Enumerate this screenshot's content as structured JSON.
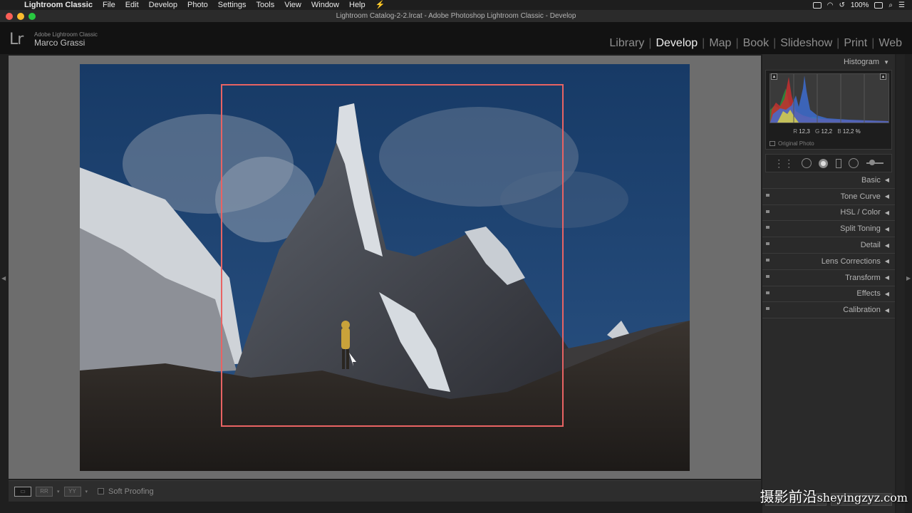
{
  "menubar": {
    "apple": "",
    "app_name": "Lightroom Classic",
    "items": [
      "File",
      "Edit",
      "Develop",
      "Photo",
      "Settings",
      "Tools",
      "View",
      "Window",
      "Help"
    ],
    "battery": "100%"
  },
  "window": {
    "title": "Lightroom Catalog-2-2.lrcat - Adobe Photoshop Lightroom Classic - Develop"
  },
  "identity": {
    "logo": "Lr",
    "product": "Adobe Lightroom Classic",
    "user": "Marco Grassi"
  },
  "modules": [
    {
      "label": "Library",
      "active": false
    },
    {
      "label": "Develop",
      "active": true
    },
    {
      "label": "Map",
      "active": false
    },
    {
      "label": "Book",
      "active": false
    },
    {
      "label": "Slideshow",
      "active": false
    },
    {
      "label": "Print",
      "active": false
    },
    {
      "label": "Web",
      "active": false
    }
  ],
  "toolbar": {
    "view_buttons": [
      "loupe",
      "before-after",
      "before-after-split"
    ],
    "soft_proofing_label": "Soft Proofing"
  },
  "right_panel": {
    "histogram": {
      "title": "Histogram",
      "r_label": "R",
      "r_value": "12,3",
      "g_label": "G",
      "g_value": "12,2",
      "b_label": "B",
      "b_value": "12,2 %",
      "original_photo_label": "Original Photo"
    },
    "panels": [
      "Basic",
      "Tone Curve",
      "HSL / Color",
      "Split Toning",
      "Detail",
      "Lens Corrections",
      "Transform",
      "Effects",
      "Calibration"
    ]
  },
  "annotation": {
    "color": "#e86363"
  },
  "watermark": {
    "main": "摄影前沿",
    "domain": "sheyingzyz.com"
  }
}
